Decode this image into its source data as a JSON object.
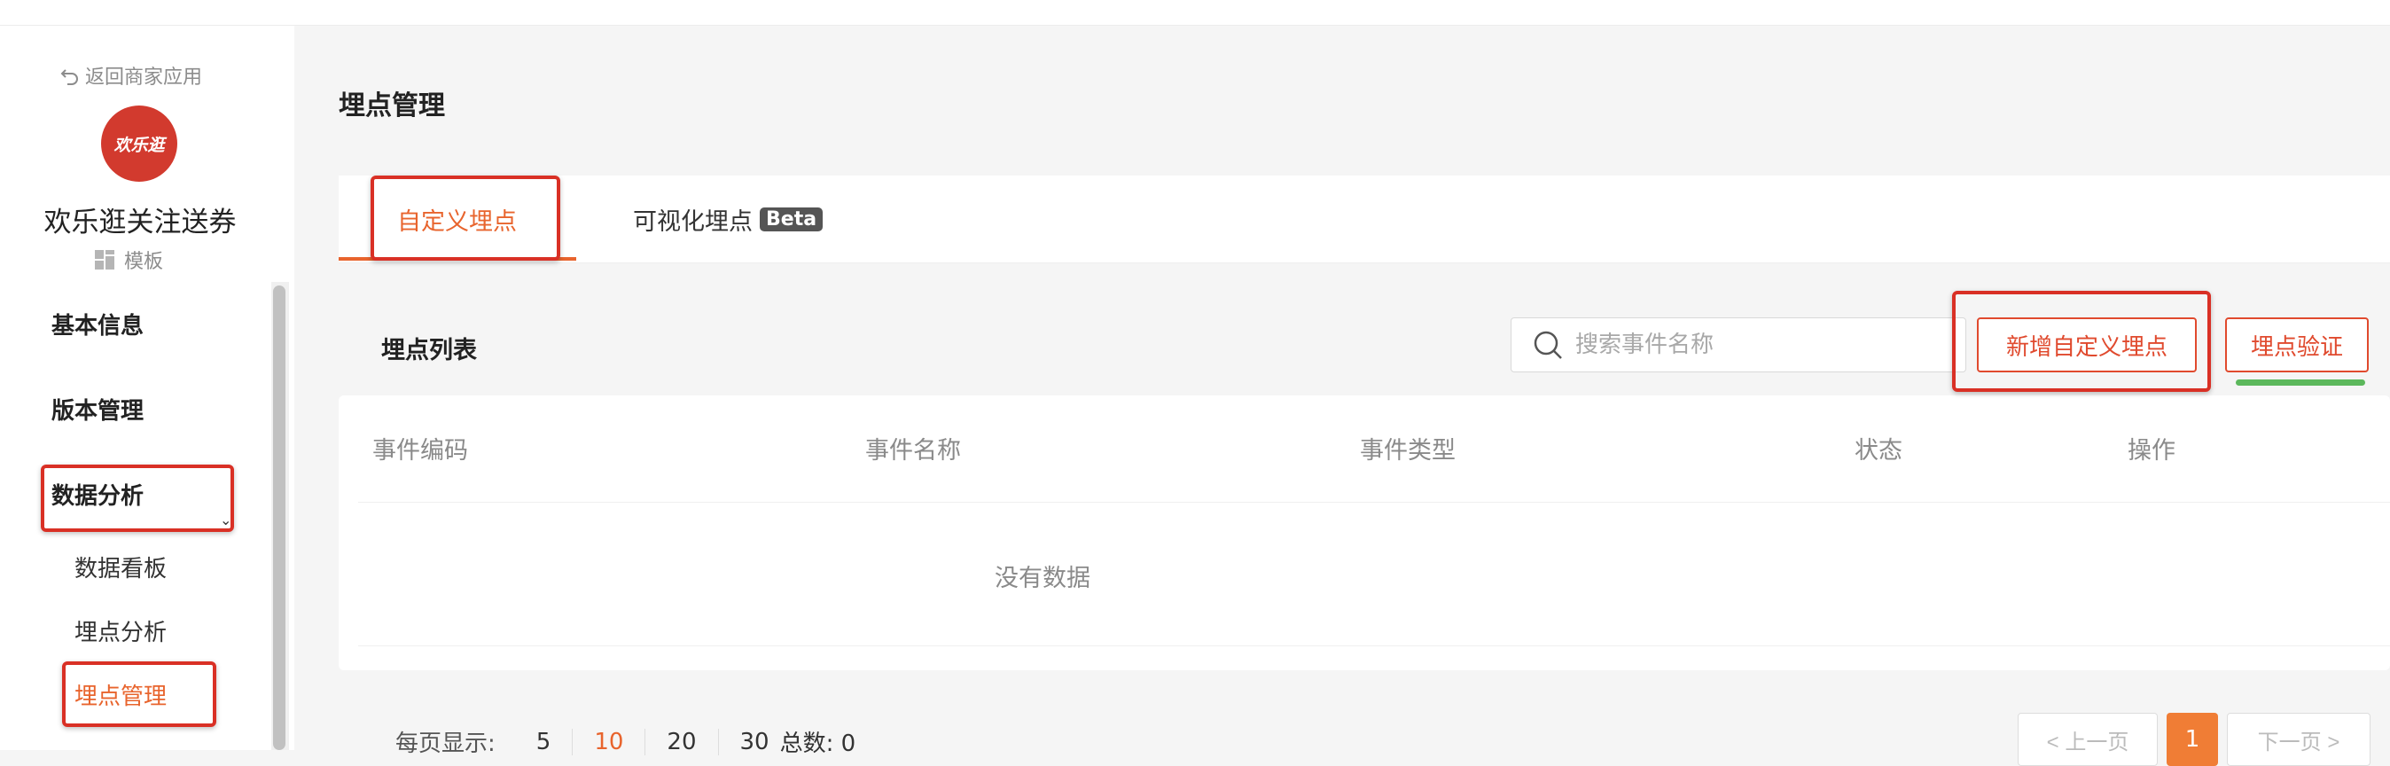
{
  "sidebar": {
    "back_label": "返回商家应用",
    "logo_text": "欢乐逛",
    "app_name": "欢乐逛关注送券",
    "template_label": "模板",
    "items": [
      {
        "label": "基本信息"
      },
      {
        "label": "版本管理"
      },
      {
        "label": "数据分析"
      }
    ],
    "sub_items": [
      {
        "label": "数据看板"
      },
      {
        "label": "埋点分析"
      },
      {
        "label": "埋点管理"
      }
    ]
  },
  "main": {
    "page_title": "埋点管理",
    "tabs": [
      {
        "label": "自定义埋点"
      },
      {
        "label": "可视化埋点",
        "badge": "Beta"
      }
    ],
    "list_title": "埋点列表",
    "search": {
      "placeholder": "搜索事件名称",
      "value": ""
    },
    "add_button": "新增自定义埋点",
    "verify_button": "埋点验证",
    "table": {
      "columns": [
        "事件编码",
        "事件名称",
        "事件类型",
        "状态",
        "操作"
      ],
      "rows": [],
      "empty_text": "没有数据"
    },
    "pagination": {
      "per_page_label": "每页显示:",
      "sizes": [
        "5",
        "10",
        "20",
        "30"
      ],
      "selected_size": "10",
      "total_label": "总数: 0",
      "prev_label": "< 上一页",
      "current_page": "1",
      "next_label": "下一页 >"
    }
  },
  "colors": {
    "accent": "#e8642d",
    "highlight_box": "#d93025",
    "underline_green": "#5cb85c",
    "logo_bg": "#d23a2e"
  }
}
